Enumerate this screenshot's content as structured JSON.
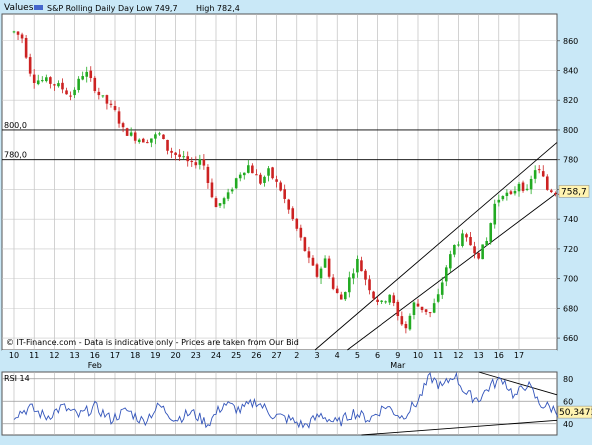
{
  "header": {
    "values_label": "Values",
    "legend_name": "S&P Rolling Daily",
    "day_low": "Day Low 749,7",
    "day_high": "High 782,4"
  },
  "footer": {
    "source_note": "© IT-Finance.com - Data is indicative only - Prices are taken from Our Bid"
  },
  "colors": {
    "frame_bg": "#c9e8f7",
    "up_candle": "#22aa22",
    "down_candle": "#cc2222",
    "rsi_line": "#3355bb",
    "price_marker_bg": "#fff3b0"
  },
  "chart_data": [
    {
      "type": "candlestick",
      "series_name": "S&P Rolling Daily",
      "y_ticks": [
        660,
        680,
        700,
        720,
        740,
        760,
        780,
        800,
        820,
        840,
        860
      ],
      "ylim": [
        652,
        878
      ],
      "x_ticks": [
        "10",
        "11",
        "12",
        "13",
        "16",
        "17",
        "18",
        "19",
        "20",
        "23",
        "24",
        "25",
        "26",
        "27",
        "2",
        "3",
        "4",
        "5",
        "6",
        "9",
        "10",
        "11",
        "12",
        "13",
        "16",
        "17"
      ],
      "month_labels": [
        {
          "text": "Feb",
          "at_tick": 4
        },
        {
          "text": "Mar",
          "at_tick": 19
        }
      ],
      "horizontal_levels": [
        {
          "label": "800,0",
          "value": 800
        },
        {
          "label": "780,0",
          "value": 780
        }
      ],
      "last_price": "758,7",
      "last_price_value": 758.7,
      "anchors": [
        {
          "t": 0,
          "v": 866
        },
        {
          "t": 0.4,
          "v": 862
        },
        {
          "t": 0.9,
          "v": 834
        },
        {
          "t": 1.6,
          "v": 833
        },
        {
          "t": 2.3,
          "v": 829
        },
        {
          "t": 2.8,
          "v": 823
        },
        {
          "t": 3.5,
          "v": 840
        },
        {
          "t": 4.2,
          "v": 824
        },
        {
          "t": 5.0,
          "v": 812
        },
        {
          "t": 5.4,
          "v": 800
        },
        {
          "t": 6.0,
          "v": 795
        },
        {
          "t": 6.5,
          "v": 793
        },
        {
          "t": 7.2,
          "v": 797
        },
        {
          "t": 7.6,
          "v": 787
        },
        {
          "t": 8.3,
          "v": 781
        },
        {
          "t": 8.8,
          "v": 776
        },
        {
          "t": 9.3,
          "v": 782
        },
        {
          "t": 9.6,
          "v": 765
        },
        {
          "t": 10.0,
          "v": 748
        },
        {
          "t": 10.6,
          "v": 756
        },
        {
          "t": 11.1,
          "v": 770
        },
        {
          "t": 11.6,
          "v": 776
        },
        {
          "t": 12.2,
          "v": 765
        },
        {
          "t": 12.6,
          "v": 772
        },
        {
          "t": 13.2,
          "v": 760
        },
        {
          "t": 13.6,
          "v": 746
        },
        {
          "t": 14.1,
          "v": 730
        },
        {
          "t": 14.6,
          "v": 712
        },
        {
          "t": 15.0,
          "v": 702
        },
        {
          "t": 15.4,
          "v": 713
        },
        {
          "t": 15.8,
          "v": 693
        },
        {
          "t": 16.2,
          "v": 686
        },
        {
          "t": 16.6,
          "v": 700
        },
        {
          "t": 17.0,
          "v": 712
        },
        {
          "t": 17.4,
          "v": 700
        },
        {
          "t": 17.8,
          "v": 688
        },
        {
          "t": 18.2,
          "v": 683
        },
        {
          "t": 18.6,
          "v": 690
        },
        {
          "t": 19.0,
          "v": 674
        },
        {
          "t": 19.4,
          "v": 667
        },
        {
          "t": 19.8,
          "v": 683
        },
        {
          "t": 20.2,
          "v": 680
        },
        {
          "t": 20.6,
          "v": 677
        },
        {
          "t": 21.0,
          "v": 688
        },
        {
          "t": 21.4,
          "v": 708
        },
        {
          "t": 21.8,
          "v": 722
        },
        {
          "t": 22.2,
          "v": 728
        },
        {
          "t": 22.6,
          "v": 723
        },
        {
          "t": 23.0,
          "v": 716
        },
        {
          "t": 23.4,
          "v": 725
        },
        {
          "t": 23.8,
          "v": 750
        },
        {
          "t": 24.2,
          "v": 758
        },
        {
          "t": 24.6,
          "v": 755
        },
        {
          "t": 25.0,
          "v": 765
        },
        {
          "t": 25.4,
          "v": 758
        },
        {
          "t": 25.8,
          "v": 774
        },
        {
          "t": 26.1,
          "v": 771
        },
        {
          "t": 26.4,
          "v": 760
        },
        {
          "t": 26.8,
          "v": 759
        },
        {
          "t": 27.0,
          "v": 758.7
        }
      ],
      "trend_lines": [
        {
          "t1": 14.9,
          "v1": 652,
          "t2": 27.6,
          "v2": 800
        },
        {
          "t1": 16.5,
          "v1": 652,
          "t2": 27.6,
          "v2": 765
        }
      ]
    },
    {
      "type": "line",
      "series_name": "RSI 14",
      "y_ticks": [
        40,
        60,
        80
      ],
      "ylim": [
        30,
        86
      ],
      "last_value": "50,3473",
      "last_value_num": 50.35,
      "anchors": [
        {
          "t": 0,
          "v": 48
        },
        {
          "t": 0.8,
          "v": 54
        },
        {
          "t": 1.6,
          "v": 46
        },
        {
          "t": 2.4,
          "v": 55
        },
        {
          "t": 3.2,
          "v": 47
        },
        {
          "t": 4.0,
          "v": 55
        },
        {
          "t": 4.8,
          "v": 44
        },
        {
          "t": 5.6,
          "v": 52
        },
        {
          "t": 6.4,
          "v": 42
        },
        {
          "t": 7.2,
          "v": 56
        },
        {
          "t": 8.0,
          "v": 44
        },
        {
          "t": 8.8,
          "v": 50
        },
        {
          "t": 9.6,
          "v": 40
        },
        {
          "t": 10.4,
          "v": 58
        },
        {
          "t": 11.2,
          "v": 52
        },
        {
          "t": 12.0,
          "v": 60
        },
        {
          "t": 12.8,
          "v": 48
        },
        {
          "t": 13.6,
          "v": 44
        },
        {
          "t": 14.4,
          "v": 38
        },
        {
          "t": 15.2,
          "v": 48
        },
        {
          "t": 16.0,
          "v": 40
        },
        {
          "t": 16.8,
          "v": 50
        },
        {
          "t": 17.6,
          "v": 44
        },
        {
          "t": 18.4,
          "v": 56
        },
        {
          "t": 19.2,
          "v": 46
        },
        {
          "t": 20.0,
          "v": 60
        },
        {
          "t": 20.6,
          "v": 82
        },
        {
          "t": 21.2,
          "v": 72
        },
        {
          "t": 21.8,
          "v": 84
        },
        {
          "t": 22.4,
          "v": 66
        },
        {
          "t": 23.0,
          "v": 62
        },
        {
          "t": 23.6,
          "v": 74
        },
        {
          "t": 24.2,
          "v": 80
        },
        {
          "t": 24.8,
          "v": 64
        },
        {
          "t": 25.4,
          "v": 76
        },
        {
          "t": 26.0,
          "v": 58
        },
        {
          "t": 26.6,
          "v": 54
        },
        {
          "t": 27.0,
          "v": 50.35
        }
      ],
      "trend_lines": [
        {
          "t1": 17.2,
          "v1": 30,
          "t2": 27.6,
          "v2": 44
        },
        {
          "t1": 23.0,
          "v1": 86,
          "t2": 27.6,
          "v2": 62
        }
      ]
    }
  ]
}
